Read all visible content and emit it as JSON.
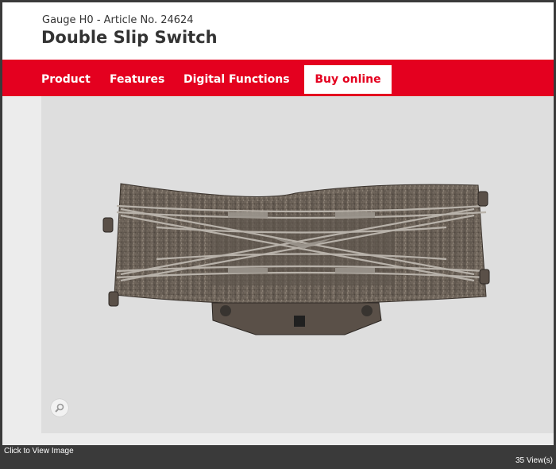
{
  "header": {
    "subtitle": "Gauge H0 - Article No. 24624",
    "title": "Double Slip Switch"
  },
  "nav": {
    "items": [
      "Product",
      "Features",
      "Digital Functions"
    ],
    "buy_label": "Buy online"
  },
  "image": {
    "subject": "double slip switch track piece",
    "zoom_icon": "magnifier-icon"
  },
  "footer": {
    "click_hint": "Click to View Image",
    "views": "35 View(s)"
  },
  "colors": {
    "brand_red": "#e4001f",
    "header_bg": "#ffffff",
    "stage_bg": "#dedede",
    "page_bg": "#3a3a3a"
  }
}
